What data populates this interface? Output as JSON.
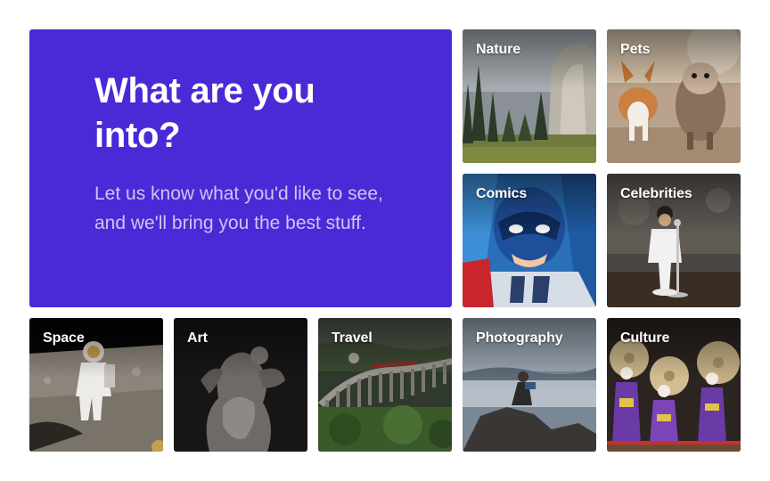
{
  "hero": {
    "title": "What are you into?",
    "subtitle": "Let us know what you'd like to see, and we'll bring you the best stuff.",
    "background_color": "#4a2ad6"
  },
  "categories": [
    {
      "label": "Nature"
    },
    {
      "label": "Pets"
    },
    {
      "label": "Comics"
    },
    {
      "label": "Celebrities"
    },
    {
      "label": "Space"
    },
    {
      "label": "Art"
    },
    {
      "label": "Travel"
    },
    {
      "label": "Photography"
    },
    {
      "label": "Culture"
    }
  ]
}
